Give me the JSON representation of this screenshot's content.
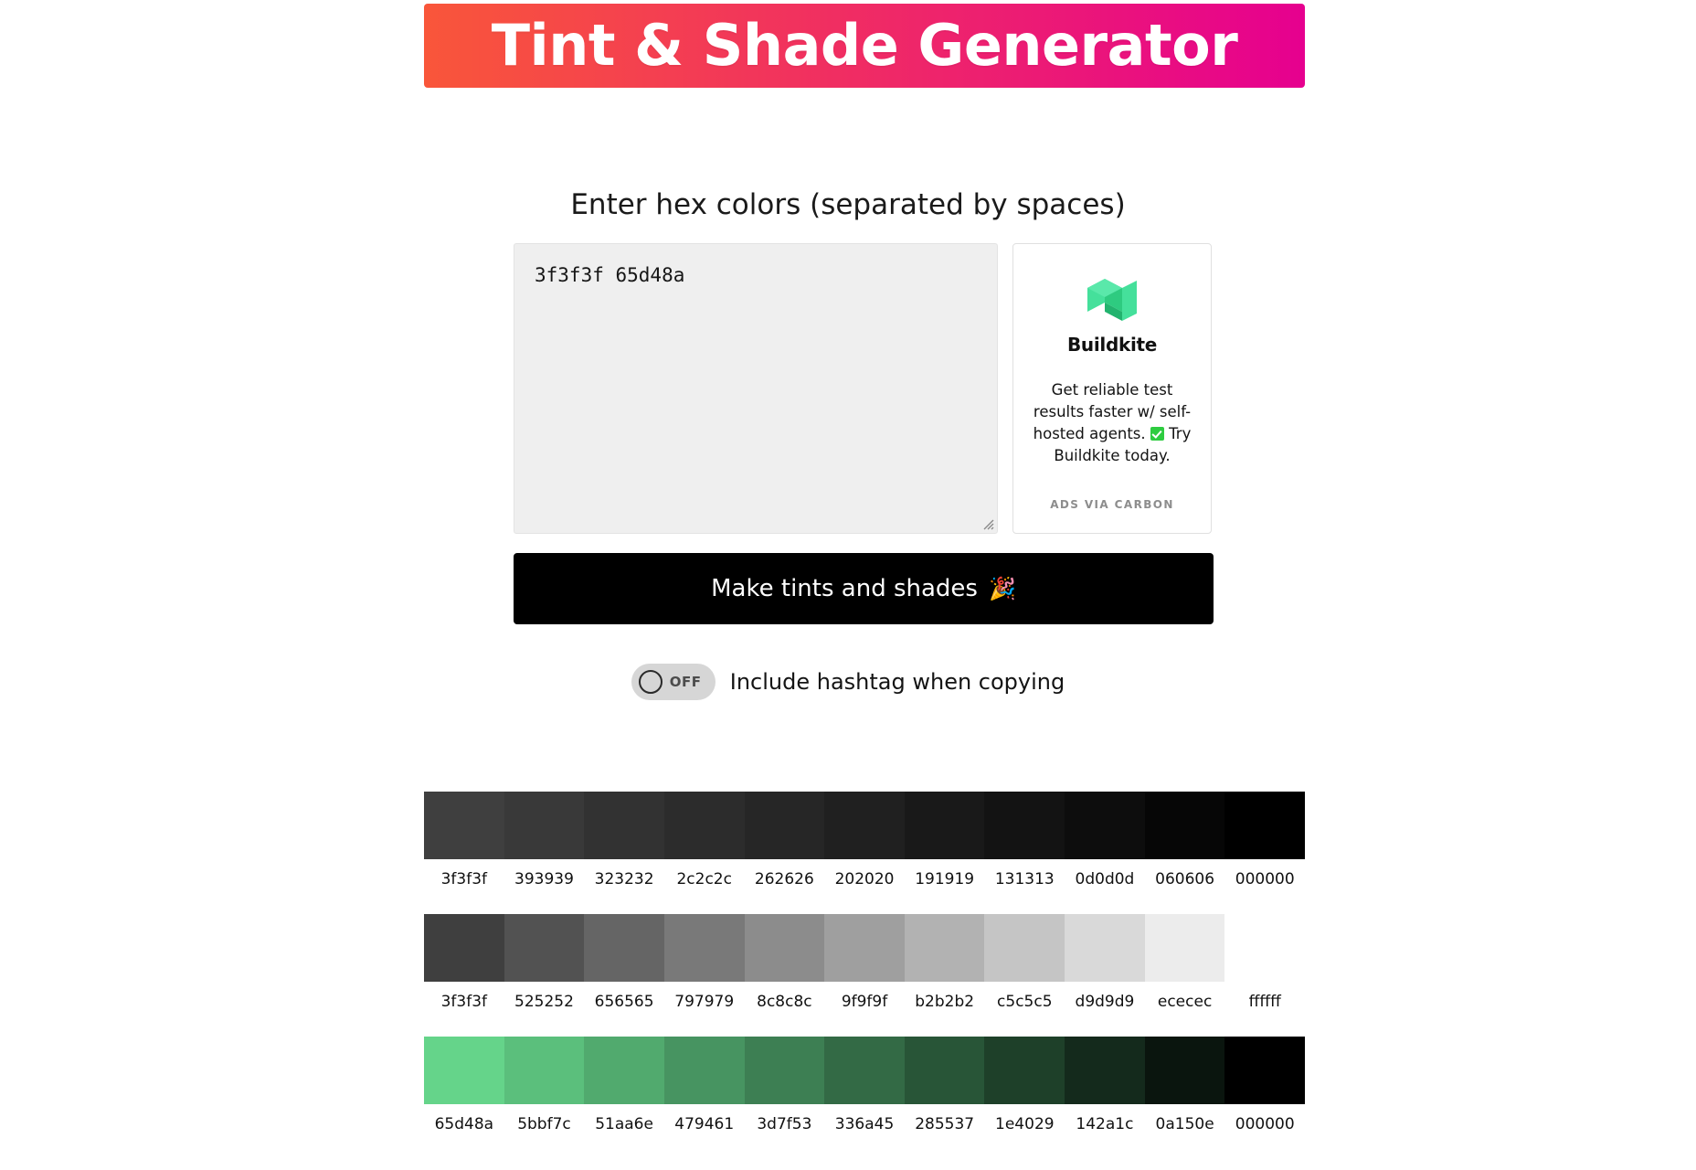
{
  "header": {
    "title": "Tint & Shade Generator",
    "gradient_from": "#f9563a",
    "gradient_to": "#e6008f"
  },
  "form": {
    "prompt_label": "Enter hex colors (separated by spaces)",
    "textarea_value": "3f3f3f 65d48a",
    "textarea_placeholder": "3f3f3f 65d48a",
    "submit_label": "Make tints and shades",
    "submit_emoji": "🎉",
    "toggle_state": "OFF",
    "toggle_label": "Include hashtag when copying"
  },
  "ad": {
    "brand": "Buildkite",
    "logo_color": "#30d17c",
    "body_part1": "Get reliable test results faster w/ self-hosted agents.",
    "body_part2": "Try Buildkite today.",
    "footer": "ADS VIA CARBON"
  },
  "palettes": [
    {
      "name": "shades-of-3f3f3f",
      "base": "3f3f3f",
      "swatches": [
        {
          "hex": "3f3f3f"
        },
        {
          "hex": "393939"
        },
        {
          "hex": "323232"
        },
        {
          "hex": "2c2c2c"
        },
        {
          "hex": "262626"
        },
        {
          "hex": "202020"
        },
        {
          "hex": "191919"
        },
        {
          "hex": "131313"
        },
        {
          "hex": "0d0d0d"
        },
        {
          "hex": "060606"
        },
        {
          "hex": "000000"
        }
      ]
    },
    {
      "name": "tints-of-3f3f3f",
      "base": "3f3f3f",
      "swatches": [
        {
          "hex": "3f3f3f"
        },
        {
          "hex": "525252"
        },
        {
          "hex": "656565"
        },
        {
          "hex": "797979"
        },
        {
          "hex": "8c8c8c"
        },
        {
          "hex": "9f9f9f"
        },
        {
          "hex": "b2b2b2"
        },
        {
          "hex": "c5c5c5"
        },
        {
          "hex": "d9d9d9"
        },
        {
          "hex": "ececec"
        },
        {
          "hex": "ffffff"
        }
      ]
    },
    {
      "name": "shades-of-65d48a",
      "base": "65d48a",
      "swatches": [
        {
          "hex": "65d48a"
        },
        {
          "hex": "5bbf7c"
        },
        {
          "hex": "51aa6e"
        },
        {
          "hex": "479461"
        },
        {
          "hex": "3d7f53"
        },
        {
          "hex": "336a45"
        },
        {
          "hex": "285537"
        },
        {
          "hex": "1e4029"
        },
        {
          "hex": "142a1c"
        },
        {
          "hex": "0a150e"
        },
        {
          "hex": "000000"
        }
      ]
    }
  ]
}
